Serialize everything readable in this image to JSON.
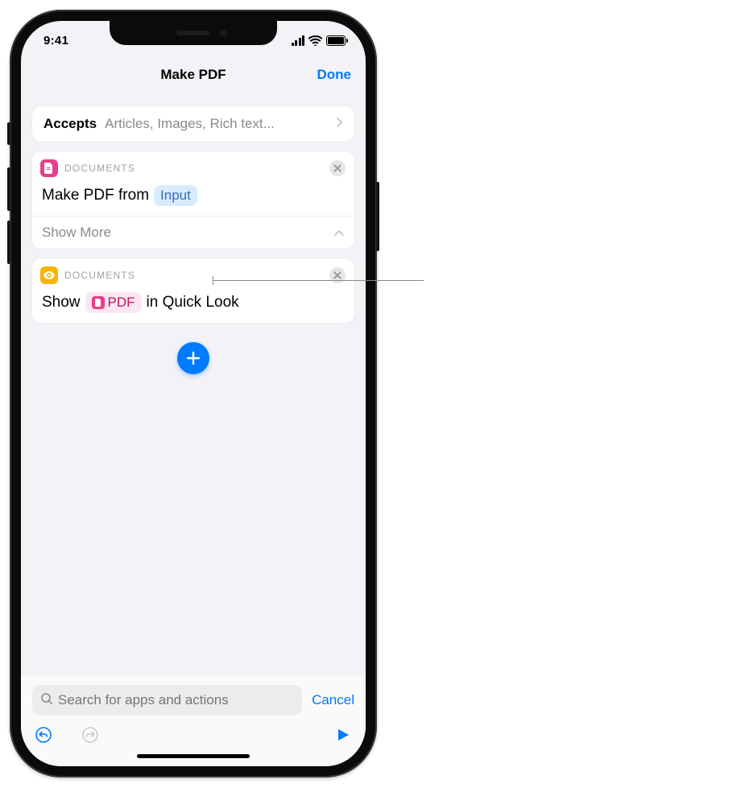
{
  "status": {
    "time": "9:41"
  },
  "nav": {
    "title": "Make PDF",
    "done": "Done"
  },
  "accepts": {
    "label": "Accepts",
    "value": "Articles, Images, Rich text..."
  },
  "actions": [
    {
      "category": "DOCUMENTS",
      "icon_color": "magenta",
      "body_prefix": "Make PDF from",
      "token": "Input",
      "show_more_label": "Show More"
    },
    {
      "category": "DOCUMENTS",
      "icon_color": "yellow",
      "body_prefix": "Show",
      "token": "PDF",
      "body_suffix": "in Quick Look"
    }
  ],
  "search": {
    "placeholder": "Search for apps and actions",
    "cancel": "Cancel"
  }
}
